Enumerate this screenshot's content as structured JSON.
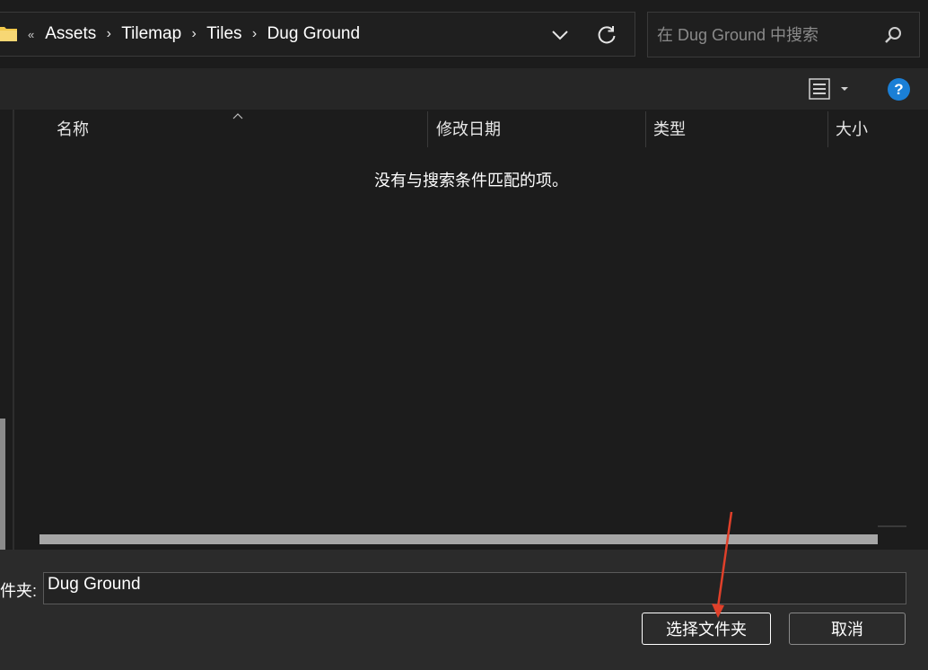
{
  "address_bar": {
    "overflow_symbol": "«",
    "breadcrumbs": [
      "Assets",
      "Tilemap",
      "Tiles",
      "Dug Ground"
    ],
    "separator": "›"
  },
  "search": {
    "placeholder": "在 Dug Ground 中搜索"
  },
  "toolbar": {
    "help_label": "?"
  },
  "file_list": {
    "columns": [
      "名称",
      "修改日期",
      "类型",
      "大小"
    ],
    "empty_message": "没有与搜索条件匹配的项。"
  },
  "bottom": {
    "folder_label": "件夹:",
    "folder_value": "Dug Ground",
    "select_button": "选择文件夹",
    "cancel_button": "取消"
  },
  "colors": {
    "background": "#1c1c1c",
    "help_blue": "#1a7fd6",
    "folder_yellow": "#f2c94c",
    "annotation_red": "#e0402a"
  },
  "icons": {
    "folder": "folder-icon",
    "dropdown": "chevron-down-icon",
    "refresh": "refresh-icon",
    "search": "search-icon",
    "view": "list-view-icon",
    "help": "help-icon"
  }
}
